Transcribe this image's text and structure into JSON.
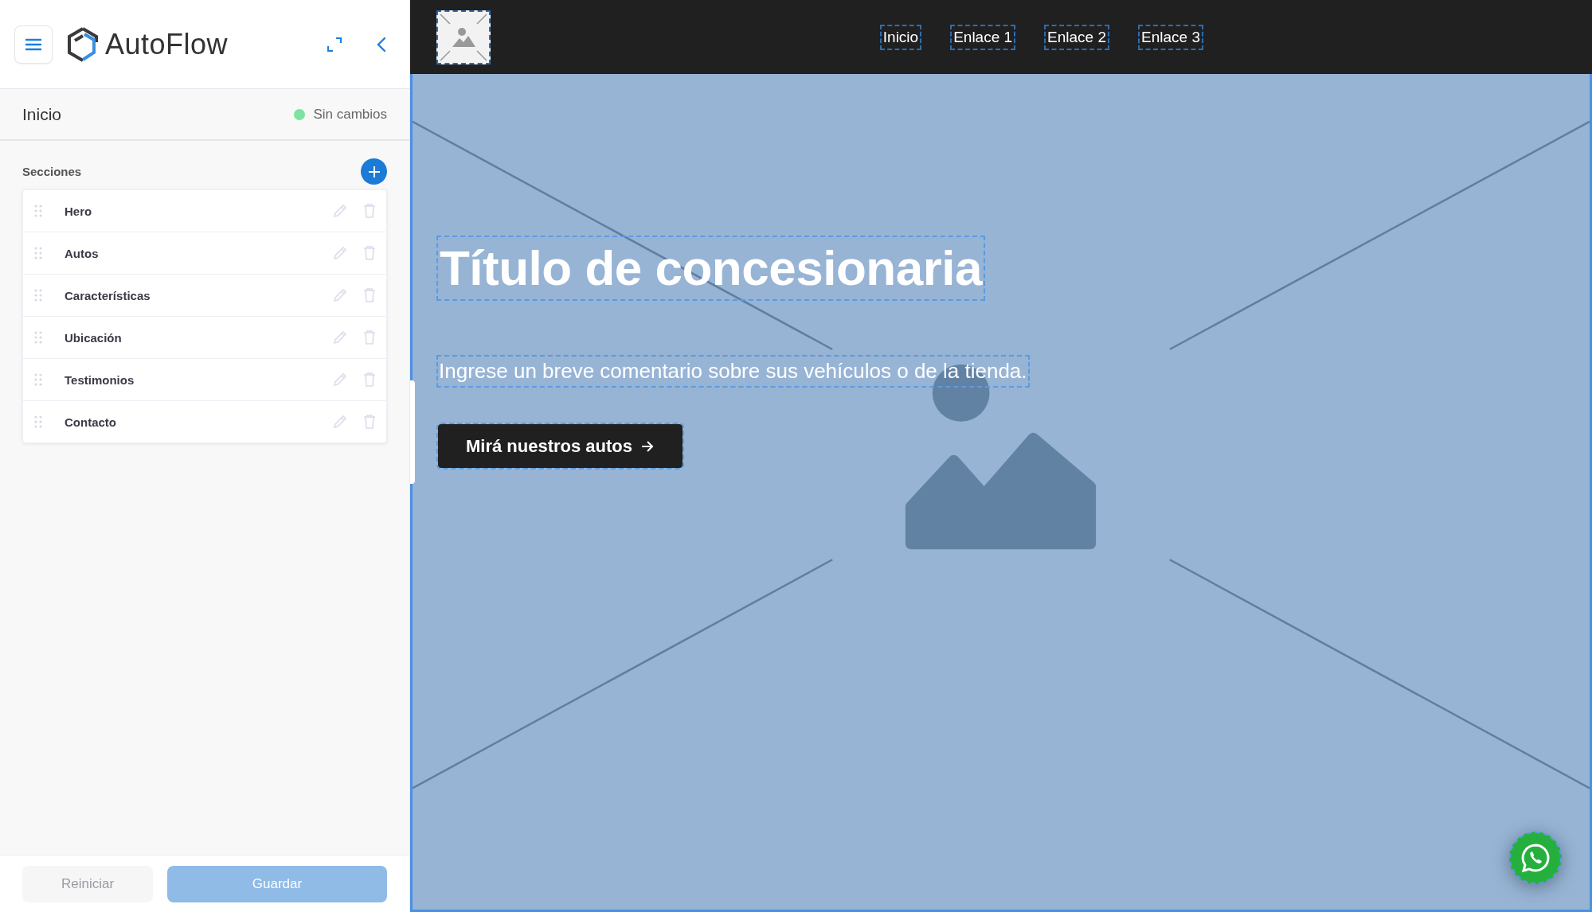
{
  "sidebar": {
    "brand": "AutoFlow",
    "page": {
      "title": "Inicio",
      "status": "Sin cambios",
      "unsaved": false
    },
    "sections_label": "Secciones",
    "sections": [
      {
        "name": "Hero"
      },
      {
        "name": "Autos"
      },
      {
        "name": "Características"
      },
      {
        "name": "Ubicación"
      },
      {
        "name": "Testimonios"
      },
      {
        "name": "Contacto"
      }
    ],
    "buttons": [
      {
        "label": "Reiniciar",
        "kind": "secondary",
        "disabled": true
      },
      {
        "label": "Guardar",
        "kind": "primary",
        "disabled": true
      }
    ]
  },
  "preview": {
    "nav": [
      "Inicio",
      "Enlace 1",
      "Enlace 2",
      "Enlace 3"
    ],
    "hero": {
      "title": "Título de concesionaria",
      "subtitle": "Ingrese un breve comentario sobre sus vehículos o de la tienda.",
      "cta": "Mirá nuestros autos"
    }
  }
}
